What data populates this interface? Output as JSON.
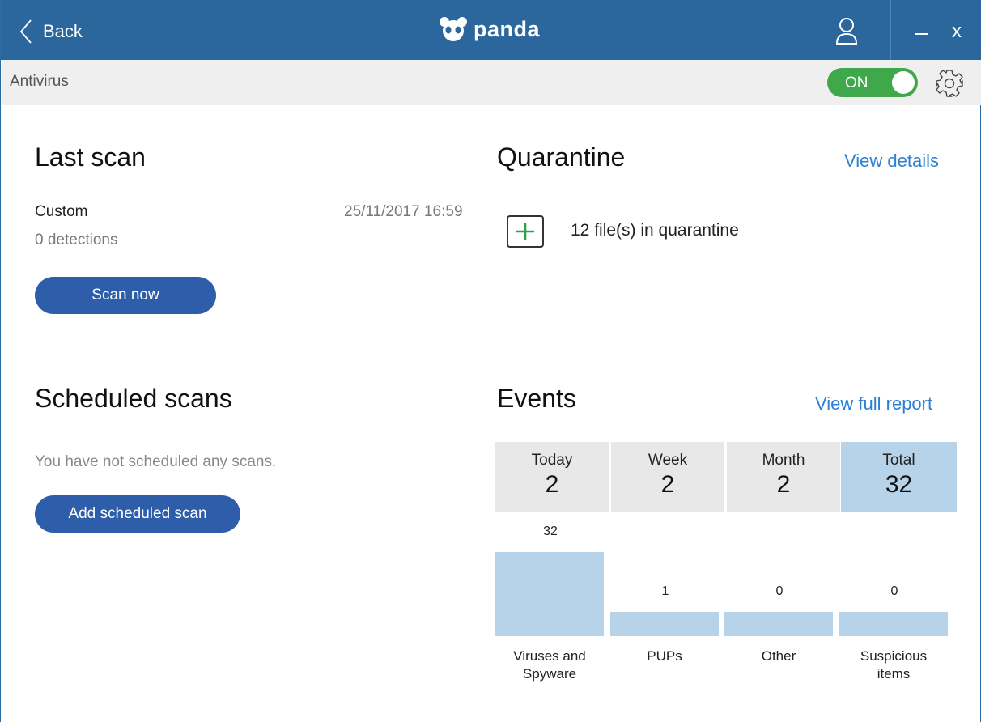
{
  "titlebar": {
    "back_label": "Back",
    "brand": "panda",
    "close_label": "x"
  },
  "subbar": {
    "section": "Antivirus",
    "toggle_label": "ON",
    "toggle_color": "#3ea84a"
  },
  "last_scan": {
    "title": "Last scan",
    "scan_type": "Custom",
    "datetime": "25/11/2017 16:59",
    "detections": "0 detections",
    "scan_button": "Scan now"
  },
  "quarantine": {
    "title": "Quarantine",
    "view_details": "View details",
    "files": "12 file(s) in quarantine"
  },
  "scheduled": {
    "title": "Scheduled scans",
    "empty_text": "You have not scheduled any scans.",
    "add_button": "Add scheduled scan"
  },
  "events": {
    "title": "Events",
    "view_report": "View full report",
    "tabs": [
      {
        "label": "Today",
        "value": "2"
      },
      {
        "label": "Week",
        "value": "2"
      },
      {
        "label": "Month",
        "value": "2"
      },
      {
        "label": "Total",
        "value": "32"
      }
    ],
    "active_tab": "Total"
  },
  "chart_data": {
    "type": "bar",
    "categories": [
      "Viruses and Spyware",
      "PUPs",
      "Other",
      "Suspicious items"
    ],
    "category_lines": [
      [
        "Viruses and",
        "Spyware"
      ],
      [
        "PUPs"
      ],
      [
        "Other"
      ],
      [
        "Suspicious",
        "items"
      ]
    ],
    "values": [
      32,
      1,
      0,
      0
    ],
    "value_labels": [
      "32",
      "1",
      "0",
      "0"
    ],
    "bar_color": "#b7d3ea"
  },
  "colors": {
    "titlebar": "#2b679c",
    "primary_button": "#2e5eaa",
    "link": "#2b7fd4",
    "accent_green": "#3ea84a"
  }
}
